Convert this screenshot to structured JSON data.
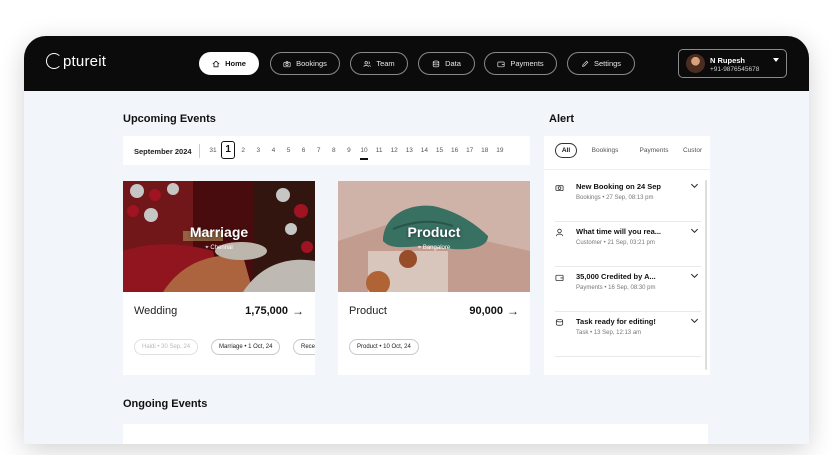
{
  "brand": {
    "logo_text": "ptureit"
  },
  "nav": [
    {
      "label": "Home",
      "icon": "home-icon",
      "active": true
    },
    {
      "label": "Bookings",
      "icon": "camera-icon"
    },
    {
      "label": "Team",
      "icon": "users-icon"
    },
    {
      "label": "Data",
      "icon": "database-icon"
    },
    {
      "label": "Payments",
      "icon": "wallet-icon"
    },
    {
      "label": "Settings",
      "icon": "pencil-icon"
    }
  ],
  "user": {
    "name": "N Rupesh",
    "phone": "+91-9876545678"
  },
  "upcoming": {
    "title": "Upcoming Events",
    "month": "September 2024",
    "days": [
      "31",
      "1",
      "2",
      "3",
      "4",
      "5",
      "6",
      "7",
      "8",
      "9",
      "10",
      "11",
      "12",
      "13",
      "14",
      "15",
      "16",
      "17",
      "18",
      "19"
    ],
    "selected_day": "1",
    "today_day": "10",
    "cards": [
      {
        "photo_title": "Marriage",
        "photo_location": "Chennai",
        "name": "Wedding",
        "amount": "1,75,000",
        "chips": [
          "Haldi • 30 Sep, 24",
          "Marriage • 1 Oct, 24",
          "Rece"
        ]
      },
      {
        "photo_title": "Product",
        "photo_location": "Bangalore",
        "name": "Product",
        "amount": "90,000",
        "chips": [
          "Product • 10 Oct, 24"
        ]
      }
    ]
  },
  "alert": {
    "title": "Alert",
    "filters": [
      "All",
      "Bookings",
      "Payments",
      "Custor"
    ],
    "items": [
      {
        "icon": "camera-icon",
        "title": "New Booking on 24 Sep",
        "category": "Bookings",
        "time": "27 Sep, 08:13 pm"
      },
      {
        "icon": "user-icon",
        "title": "What time will you rea...",
        "category": "Customer",
        "time": "21 Sep, 03:21 pm"
      },
      {
        "icon": "wallet-icon",
        "title": "35,000 Credited by A...",
        "category": "Payments",
        "time": "16 Sep, 08:30 pm"
      },
      {
        "icon": "task-icon",
        "title": "Task ready for editing!",
        "category": "Task",
        "time": "13 Sep, 12:13 am"
      }
    ]
  },
  "ongoing": {
    "title": "Ongoing Events"
  },
  "colors": {
    "topbar": "#0b0b0b",
    "background": "#f2f5fa",
    "card": "#ffffff"
  }
}
